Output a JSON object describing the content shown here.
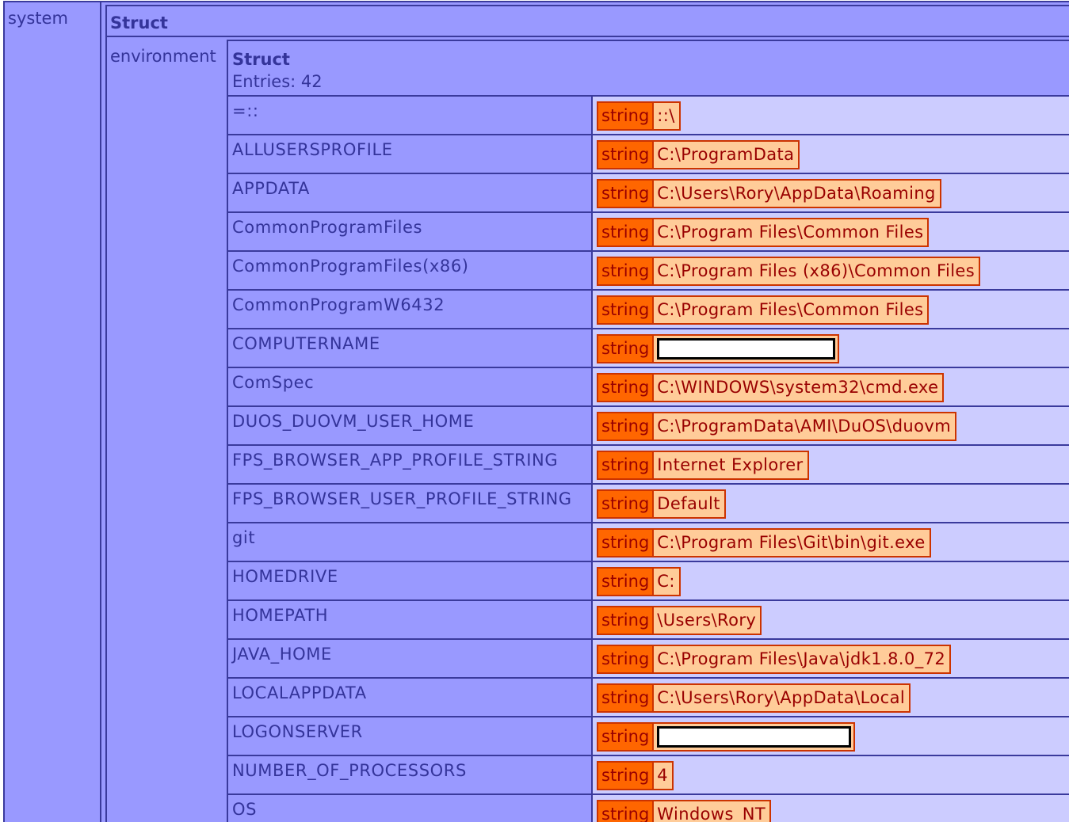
{
  "system": {
    "label": "system"
  },
  "struct": {
    "title": "Struct",
    "env_label": "environment"
  },
  "environment": {
    "title": "Struct",
    "entries_text": "Entries: 42",
    "rows": [
      {
        "key": "=::",
        "type": "string",
        "value": "::\\"
      },
      {
        "key": "ALLUSERSPROFILE",
        "type": "string",
        "value": "C:\\ProgramData"
      },
      {
        "key": "APPDATA",
        "type": "string",
        "value": "C:\\Users\\Rory\\AppData\\Roaming"
      },
      {
        "key": "CommonProgramFiles",
        "type": "string",
        "value": "C:\\Program Files\\Common Files"
      },
      {
        "key": "CommonProgramFiles(x86)",
        "type": "string",
        "value": "C:\\Program Files (x86)\\Common Files"
      },
      {
        "key": "CommonProgramW6432",
        "type": "string",
        "value": "C:\\Program Files\\Common Files"
      },
      {
        "key": "COMPUTERNAME",
        "type": "string",
        "value": "",
        "redacted": true,
        "redact_size": "medium"
      },
      {
        "key": "ComSpec",
        "type": "string",
        "value": "C:\\WINDOWS\\system32\\cmd.exe"
      },
      {
        "key": "DUOS_DUOVM_USER_HOME",
        "type": "string",
        "value": "C:\\ProgramData\\AMI\\DuOS\\duovm"
      },
      {
        "key": "FPS_BROWSER_APP_PROFILE_STRING",
        "type": "string",
        "value": "Internet Explorer"
      },
      {
        "key": "FPS_BROWSER_USER_PROFILE_STRING",
        "type": "string",
        "value": "Default"
      },
      {
        "key": "git",
        "type": "string",
        "value": "C:\\Program Files\\Git\\bin\\git.exe"
      },
      {
        "key": "HOMEDRIVE",
        "type": "string",
        "value": "C:"
      },
      {
        "key": "HOMEPATH",
        "type": "string",
        "value": "\\Users\\Rory"
      },
      {
        "key": "JAVA_HOME",
        "type": "string",
        "value": "C:\\Program Files\\Java\\jdk1.8.0_72"
      },
      {
        "key": "LOCALAPPDATA",
        "type": "string",
        "value": "C:\\Users\\Rory\\AppData\\Local"
      },
      {
        "key": "LOGONSERVER",
        "type": "string",
        "value": "",
        "redacted": true,
        "redact_size": "large"
      },
      {
        "key": "NUMBER_OF_PROCESSORS",
        "type": "string",
        "value": "4"
      },
      {
        "key": "OS",
        "type": "string",
        "value": "Windows_NT"
      }
    ]
  },
  "colors": {
    "panel": "#9999ff",
    "value_bg": "#ccccff",
    "border": "#3a3a9c",
    "string_type_bg": "#ff6600",
    "string_value_bg": "#ffcc99",
    "string_text": "#990000"
  }
}
